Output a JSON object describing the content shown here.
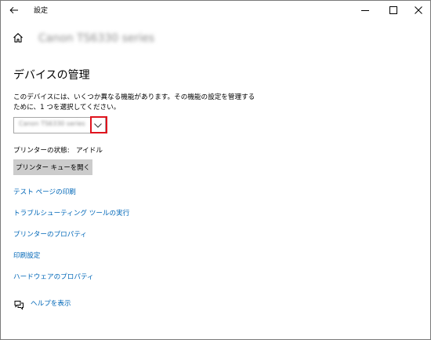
{
  "window": {
    "title": "設定"
  },
  "header": {
    "device_name": "Canon TS6330 series"
  },
  "section": {
    "title": "デバイスの管理",
    "description": "このデバイスには、いくつか異なる機能があります。その機能の設定を管理するために、1 つを選択してください。"
  },
  "dropdown": {
    "selected": "Canon TS6330 series"
  },
  "printer_status": {
    "label": "プリンターの状態:",
    "value": "アイドル"
  },
  "queue_button": {
    "label": "プリンター キューを開く"
  },
  "links": [
    {
      "label": "テスト ページの印刷"
    },
    {
      "label": "トラブルシューティング ツールの実行"
    },
    {
      "label": "プリンターのプロパティ"
    },
    {
      "label": "印刷設定"
    },
    {
      "label": "ハードウェアのプロパティ"
    }
  ],
  "help": {
    "label": "ヘルプを表示"
  },
  "colors": {
    "link": "#0067b8",
    "highlight": "#e0141e",
    "button_bg": "#cccccc"
  },
  "icons": {
    "back": "arrow-left-icon",
    "home": "home-icon",
    "dropdown": "chevron-down-icon",
    "help": "help-chat-icon",
    "minimize": "minimize-icon",
    "maximize": "maximize-icon",
    "close": "close-icon"
  }
}
